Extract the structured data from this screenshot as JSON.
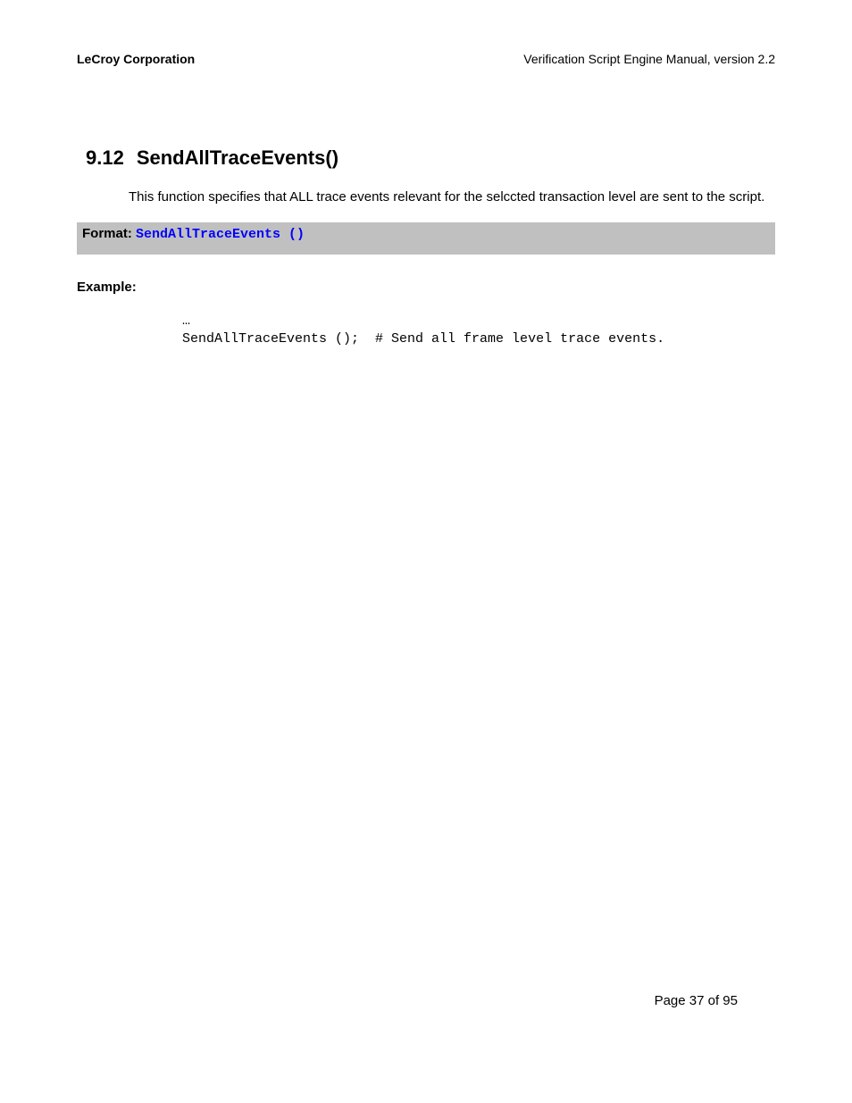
{
  "header": {
    "left": "LeCroy Corporation",
    "right": "Verification Script Engine Manual, version 2.2"
  },
  "section": {
    "number": "9.12",
    "title": "SendAllTraceEvents()"
  },
  "description": "This function specifies that ALL trace events relevant for the selccted transaction level are sent to the script.",
  "format": {
    "label": "Format: ",
    "code": "SendAllTraceEvents ()"
  },
  "example": {
    "label": "Example:",
    "line1": "…",
    "line2": "SendAllTraceEvents ();  # Send all frame level trace events."
  },
  "footer": "Page 37 of 95"
}
